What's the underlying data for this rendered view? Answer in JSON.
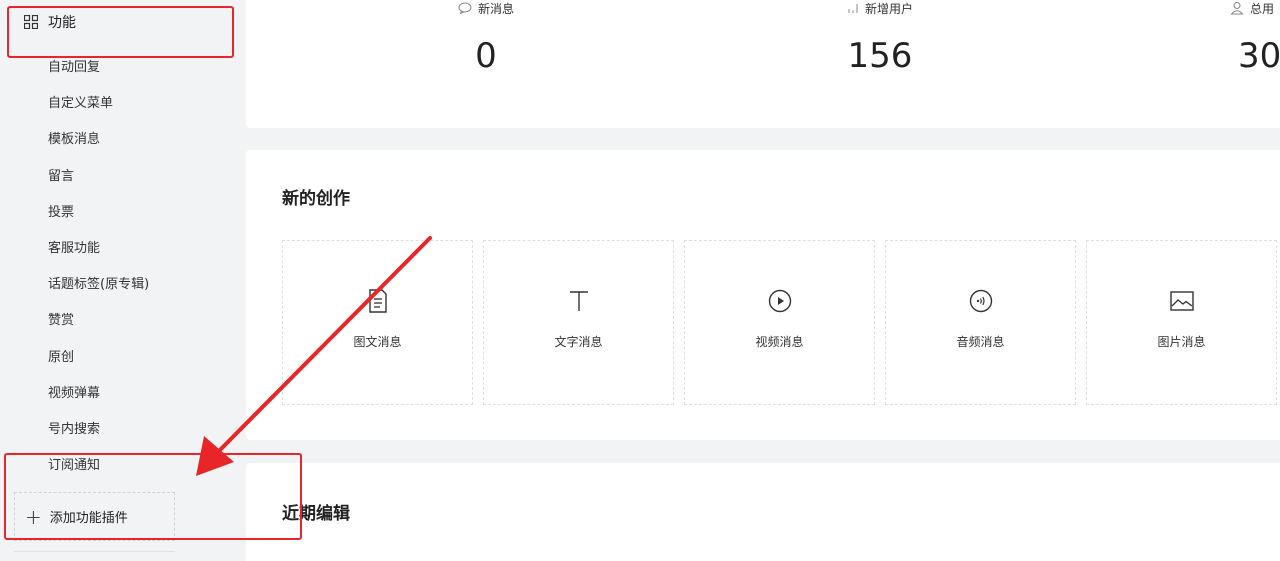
{
  "sidebar": {
    "group_label": "功能",
    "items": [
      {
        "label": "自动回复"
      },
      {
        "label": "自定义菜单"
      },
      {
        "label": "模板消息"
      },
      {
        "label": "留言"
      },
      {
        "label": "投票"
      },
      {
        "label": "客服功能"
      },
      {
        "label": "话题标签(原专辑)"
      },
      {
        "label": "赞赏"
      },
      {
        "label": "原创"
      },
      {
        "label": "视频弹幕"
      },
      {
        "label": "号内搜索"
      },
      {
        "label": "订阅通知"
      }
    ],
    "add_plugin_label": "添加功能插件"
  },
  "stats": [
    {
      "label": "新消息",
      "value": "0",
      "icon": "chat-bubble-icon"
    },
    {
      "label": "新增用户",
      "value": "156",
      "icon": "bar-chart-icon"
    },
    {
      "label": "总用",
      "value": "30",
      "icon": "user-icon"
    }
  ],
  "create_section": {
    "title": "新的创作",
    "tiles": [
      {
        "label": "图文消息",
        "icon": "document-icon"
      },
      {
        "label": "文字消息",
        "icon": "text-icon"
      },
      {
        "label": "视频消息",
        "icon": "play-icon"
      },
      {
        "label": "音频消息",
        "icon": "audio-icon"
      },
      {
        "label": "图片消息",
        "icon": "image-icon"
      }
    ]
  },
  "recent_section": {
    "title": "近期编辑"
  },
  "colors": {
    "annotation_red": "#e8262a",
    "background": "#f2f3f5",
    "card": "#ffffff"
  }
}
